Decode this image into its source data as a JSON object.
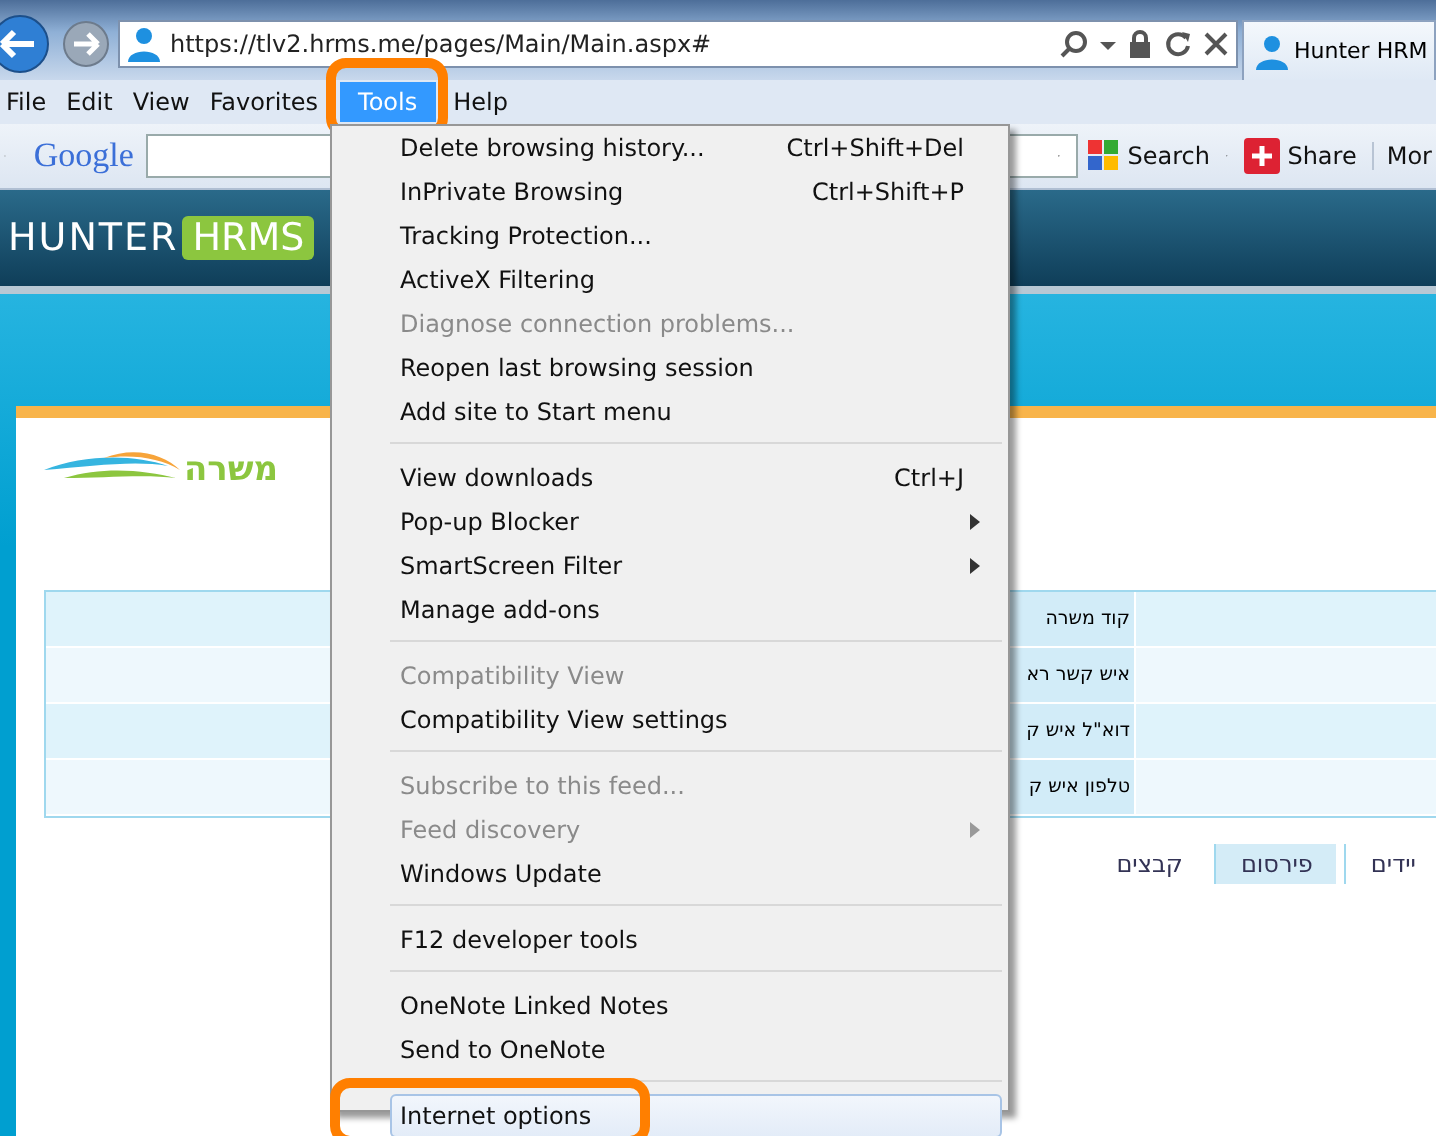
{
  "browser": {
    "address": {
      "url": "https://tlv2.hrms.me/pages/Main/Main.aspx#"
    },
    "tab": {
      "title": "Hunter HRM"
    }
  },
  "menu_bar": [
    {
      "label": "File",
      "selected": false,
      "annotated": false
    },
    {
      "label": "Edit",
      "selected": false,
      "annotated": false
    },
    {
      "label": "View",
      "selected": false,
      "annotated": false
    },
    {
      "label": "Favorites",
      "selected": false,
      "annotated": false
    },
    {
      "label": "Tools",
      "selected": true,
      "annotated": true
    },
    {
      "label": "Help",
      "selected": false,
      "annotated": false
    }
  ],
  "toolbar": {
    "logo": "Google",
    "search_button": "Search",
    "share_button": "Share",
    "more_button": "Mor"
  },
  "site": {
    "logo": [
      "HUNTER",
      "HRMS"
    ],
    "company_logo": "משרה",
    "form_rows": [
      {
        "label": "קוד משרה"
      },
      {
        "label": "איש קשר רא"
      },
      {
        "label": "דוא\"ל איש ק"
      },
      {
        "label": "טלפון איש ק"
      }
    ],
    "tabs": [
      {
        "label": "יידים",
        "selected": false
      },
      {
        "label": "פירסום",
        "selected": true
      },
      {
        "label": "קבצים",
        "selected": false
      }
    ]
  },
  "tools_menu": [
    {
      "kind": "item",
      "label": "Delete browsing history...",
      "shortcut": "Ctrl+Shift+Del",
      "disabled": false,
      "submenu": false,
      "selected": false,
      "annotated": false
    },
    {
      "kind": "item",
      "label": "InPrivate Browsing",
      "shortcut": "Ctrl+Shift+P",
      "disabled": false,
      "submenu": false,
      "selected": false,
      "annotated": false
    },
    {
      "kind": "item",
      "label": "Tracking Protection...",
      "disabled": false,
      "submenu": false,
      "selected": false,
      "annotated": false
    },
    {
      "kind": "item",
      "label": "ActiveX Filtering",
      "disabled": false,
      "submenu": false,
      "selected": false,
      "annotated": false
    },
    {
      "kind": "item",
      "label": "Diagnose connection problems...",
      "disabled": true,
      "submenu": false,
      "selected": false,
      "annotated": false
    },
    {
      "kind": "item",
      "label": "Reopen last browsing session",
      "disabled": false,
      "submenu": false,
      "selected": false,
      "annotated": false
    },
    {
      "kind": "item",
      "label": "Add site to Start menu",
      "disabled": false,
      "submenu": false,
      "selected": false,
      "annotated": false
    },
    {
      "kind": "separator"
    },
    {
      "kind": "item",
      "label": "View downloads",
      "shortcut": "Ctrl+J",
      "disabled": false,
      "submenu": false,
      "selected": false,
      "annotated": false
    },
    {
      "kind": "item",
      "label": "Pop-up Blocker",
      "disabled": false,
      "submenu": true,
      "selected": false,
      "annotated": false
    },
    {
      "kind": "item",
      "label": "SmartScreen Filter",
      "disabled": false,
      "submenu": true,
      "selected": false,
      "annotated": false
    },
    {
      "kind": "item",
      "label": "Manage add-ons",
      "disabled": false,
      "submenu": false,
      "selected": false,
      "annotated": false
    },
    {
      "kind": "separator"
    },
    {
      "kind": "item",
      "label": "Compatibility View",
      "disabled": true,
      "submenu": false,
      "selected": false,
      "annotated": false
    },
    {
      "kind": "item",
      "label": "Compatibility View settings",
      "disabled": false,
      "submenu": false,
      "selected": false,
      "annotated": false
    },
    {
      "kind": "separator"
    },
    {
      "kind": "item",
      "label": "Subscribe to this feed...",
      "disabled": true,
      "submenu": false,
      "selected": false,
      "annotated": false
    },
    {
      "kind": "item",
      "label": "Feed discovery",
      "disabled": true,
      "submenu": true,
      "selected": false,
      "annotated": false
    },
    {
      "kind": "item",
      "label": "Windows Update",
      "disabled": false,
      "submenu": false,
      "selected": false,
      "annotated": false
    },
    {
      "kind": "separator"
    },
    {
      "kind": "item",
      "label": "F12 developer tools",
      "disabled": false,
      "submenu": false,
      "selected": false,
      "annotated": false
    },
    {
      "kind": "separator"
    },
    {
      "kind": "item",
      "label": "OneNote Linked Notes",
      "disabled": false,
      "submenu": false,
      "selected": false,
      "annotated": false
    },
    {
      "kind": "item",
      "label": "Send to OneNote",
      "disabled": false,
      "submenu": false,
      "selected": false,
      "annotated": false
    },
    {
      "kind": "separator"
    },
    {
      "kind": "item",
      "label": "Internet options",
      "disabled": false,
      "submenu": false,
      "selected": true,
      "annotated": true
    }
  ]
}
